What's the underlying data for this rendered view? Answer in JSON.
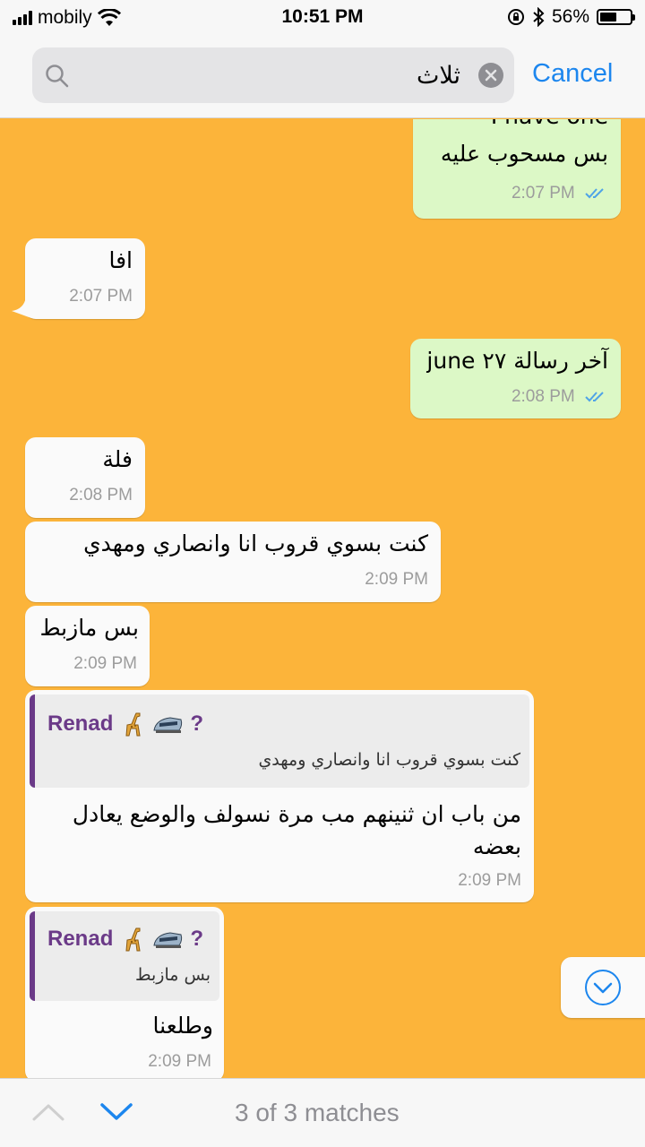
{
  "status_bar": {
    "carrier": "mobily",
    "time": "10:51 PM",
    "battery": "56%",
    "battery_level": 0.56
  },
  "search": {
    "query": "ثلاث",
    "cancel_label": "Cancel"
  },
  "messages": [
    {
      "direction": "out",
      "text_top_partial": "I have one",
      "text": "بس مسحوب عليه",
      "time": "2:07 PM",
      "status": "read"
    },
    {
      "direction": "in",
      "text": "افا",
      "time": "2:07 PM"
    },
    {
      "direction": "out",
      "text": "آخر رسالة ٢٧ june",
      "time": "2:08 PM",
      "status": "read"
    },
    {
      "direction": "in",
      "text": "فلة",
      "time": "2:08 PM"
    },
    {
      "direction": "in",
      "text": "كنت بسوي قروب انا وانصاري ومهدي",
      "time": "2:09 PM"
    },
    {
      "direction": "in",
      "text": "بس مازبط",
      "time": "2:09 PM"
    },
    {
      "direction": "in",
      "reply_to": {
        "name": "Renad",
        "emojis": "?",
        "text": "كنت بسوي قروب انا وانصاري ومهدي"
      },
      "text_line1": "من باب ان ثنينهم مب مرة نسولف والوضع يعادل",
      "text_line2": "بعضه",
      "time": "2:09 PM"
    },
    {
      "direction": "in",
      "reply_to": {
        "name": "Renad",
        "emojis": "?",
        "text": "بس مازبط"
      },
      "text": "وطلعنا",
      "time": "2:09 PM"
    }
  ],
  "bottom_bar": {
    "matches_label": "3 of 3 matches"
  },
  "colors": {
    "wallpaper": "#fcb43a",
    "outgoing_bubble": "#dcf8c6",
    "incoming_bubble": "#fafafa",
    "accent": "#1c86ee",
    "reply_name": "#6b3a88"
  }
}
